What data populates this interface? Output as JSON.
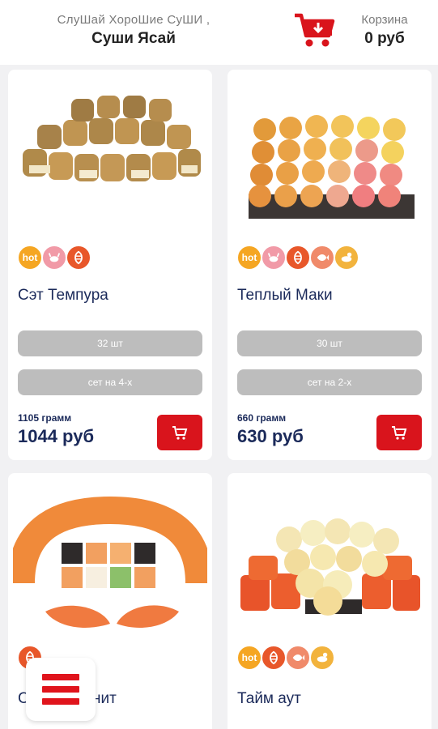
{
  "header": {
    "tagline": "СлуШай ХороШие СуШИ ,",
    "brand": "Суши Ясай",
    "cart_label": "Корзина",
    "cart_total": "0 руб",
    "cart_icon": "shopping-cart-download-icon"
  },
  "products": [
    {
      "title": "Сэт Темпура",
      "tags": [
        "hot",
        "crab",
        "shrimp"
      ],
      "pieces": "32 шт",
      "serving": "сет на 4-х",
      "weight": "1105 грамм",
      "price": "1044 руб"
    },
    {
      "title": "Теплый Маки",
      "tags": [
        "hot",
        "crab",
        "shrimp",
        "fish",
        "chicken"
      ],
      "pieces": "30 шт",
      "serving": "сет на 2-х",
      "weight": "660 грамм",
      "price": "630 руб"
    },
    {
      "title": "Софья Манит",
      "tags": [
        "shrimp"
      ]
    },
    {
      "title": "Тайм аут",
      "tags": [
        "hot",
        "shrimp",
        "fish",
        "chicken"
      ]
    }
  ],
  "tag_labels": {
    "hot": "hot"
  },
  "colors": {
    "accent_red": "#d9141c",
    "navy": "#1b2a5a",
    "hot_tag": "#f5a623",
    "crab_tag": "#f19aa7",
    "shrimp_tag": "#e8572a",
    "fish_tag": "#f08a6a",
    "chicken_tag": "#f2b33d",
    "pill_gray": "#bdbdbd"
  },
  "menu_button_icon": "hamburger-menu-icon"
}
